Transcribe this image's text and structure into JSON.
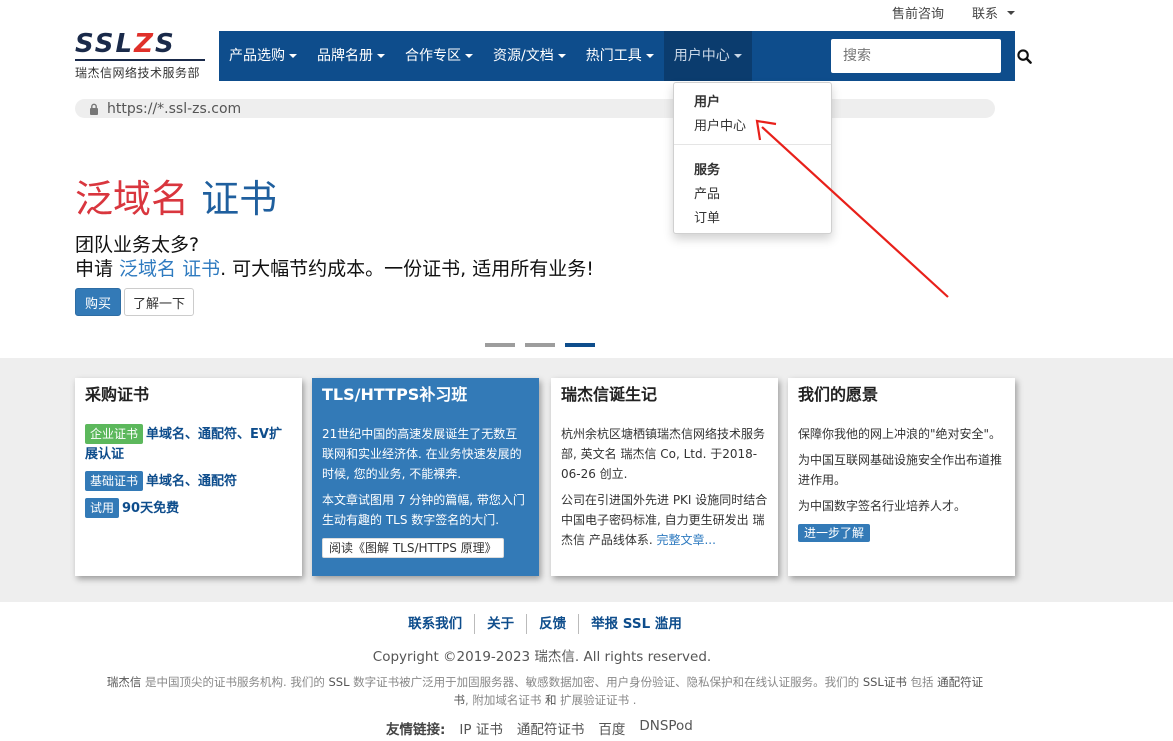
{
  "top_links": [
    {
      "label": "售前咨询",
      "has_caret": false
    },
    {
      "label": "联系",
      "has_caret": true
    }
  ],
  "logo": {
    "mark_dark_1": "SSL",
    "mark_red": "Z",
    "mark_dark_2": "S",
    "subtitle": "瑞杰信网络技术服务部"
  },
  "nav": {
    "items": [
      {
        "label": "产品选购"
      },
      {
        "label": "品牌名册"
      },
      {
        "label": "合作专区"
      },
      {
        "label": "资源/文档"
      },
      {
        "label": "热门工具"
      },
      {
        "label": "用户中心",
        "active": true
      }
    ],
    "search_placeholder": "搜索",
    "search_icon": "search-icon"
  },
  "url": "https://*.ssl-zs.com",
  "hero": {
    "title_red": "泛域名",
    "title_blue": "证书",
    "line1": "团队业务太多?",
    "line2_prefix": "申请 ",
    "line2_link": "泛域名 证书",
    "line2_suffix": ". 可大幅节约成本。一份证书, 适用所有业务!",
    "buy_label": "购买",
    "more_label": "了解一下",
    "slide_count": 3,
    "active_slide": 3
  },
  "dropdown": {
    "section1_header": "用户",
    "section1_items": [
      "用户中心"
    ],
    "section2_header": "服务",
    "section2_items": [
      "产品",
      "订单"
    ]
  },
  "cards": [
    {
      "title": "采购证书",
      "rows": [
        {
          "tag": "企业证书",
          "tag_color": "#5cb85c",
          "text": "单域名、通配符、EV扩展认证"
        },
        {
          "tag": "基础证书",
          "tag_color": "#337ab7",
          "text": "单域名、通配符"
        },
        {
          "tag": "试用",
          "tag_color": "#337ab7",
          "text": "90天免费"
        }
      ]
    },
    {
      "title": "TLS/HTTPS补习班",
      "p1": "21世纪中国的高速发展诞生了无数互联网和实业经济体. 在业务快速发展的时候, 您的业务, 不能裸奔.",
      "p2": "本文章试图用 7 分钟的篇幅, 带您入门生动有趣的 TLS 数字签名的大门.",
      "button": "阅读《图解 TLS/HTTPS 原理》"
    },
    {
      "title": "瑞杰信诞生记",
      "p1": "杭州余杭区塘栖镇瑞杰信网络技术服务部, 英文名 瑞杰信 Co, Ltd. 于2018-06-26 创立.",
      "p2": "公司在引进国外先进 PKI 设施同时结合中国电子密码标准, 自力更生研发出 瑞杰信 产品线体系.",
      "link": "完整文章..."
    },
    {
      "title": "我们的愿景",
      "p1": "保障你我他的网上冲浪的\"绝对安全\"。",
      "p2": "为中国互联网基础设施安全作出布道推进作用。",
      "p3": "为中国数字签名行业培养人才。",
      "button": "进一步了解"
    }
  ],
  "footer": {
    "links": [
      "联系我们",
      "关于",
      "反馈",
      "举报 SSL 滥用"
    ],
    "copyright": "Copyright ©2019-2023 瑞杰信. All rights reserved.",
    "about_1": "瑞杰信",
    "about_2": " 是中国顶尖的证书服务机构. 我们的 ",
    "about_3": "SSL",
    "about_4": " 数字证书被广泛用于加固服务器、敏感数据加密、用户身份验证、隐私保护和在线认证服务。我们的 ",
    "about_5": "SSL证书",
    "about_6": " 包括 ",
    "about_7": "通配符证书",
    "about_8": ", 附加域名证书 ",
    "about_9": "和",
    "about_10": " 扩展验证证书",
    "about_11": " .",
    "friends_label": "友情链接:",
    "friends": [
      "IP 证书",
      "通配符证书",
      "百度",
      "DNSPod"
    ]
  },
  "colors": {
    "nav_bg": "#0e4d8c",
    "nav_active_bg": "#0b3c6e",
    "primary": "#337ab7",
    "success": "#5cb85c",
    "hero_red": "#d9363e",
    "annotation_arrow": "#e8201a"
  }
}
